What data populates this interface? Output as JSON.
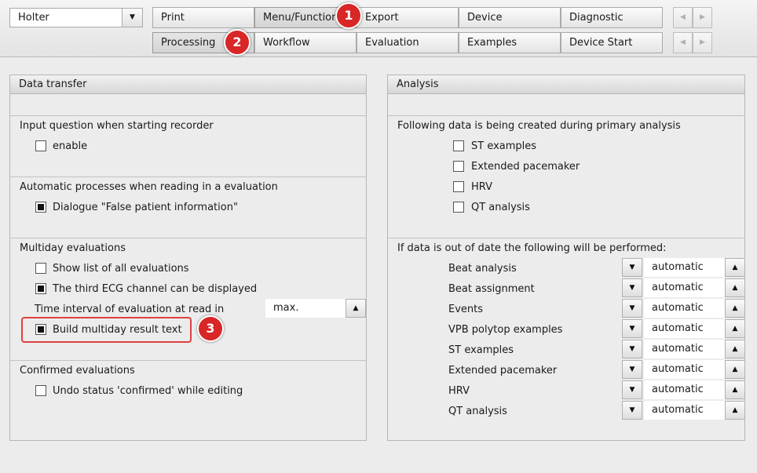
{
  "mode_select": {
    "value": "Holter"
  },
  "tabs_row1": [
    "Print",
    "Menu/Functions",
    "Export",
    "Device",
    "Diagnostic"
  ],
  "tabs_row2": [
    "Processing",
    "Workflow",
    "Evaluation",
    "Examples",
    "Device Start"
  ],
  "badges": [
    "1",
    "2",
    "3"
  ],
  "data_transfer": {
    "title": "Data transfer",
    "input_question": {
      "heading": "Input question when starting recorder",
      "enable": "enable"
    },
    "automatic": {
      "heading": "Automatic processes when reading in a evaluation",
      "dialogue": "Dialogue \"False patient information\""
    },
    "multiday": {
      "heading": "Multiday evaluations",
      "show_list": "Show list of all evaluations",
      "third_channel": "The third ECG channel can be displayed",
      "interval_label": "Time interval of evaluation at read in",
      "interval_value": "max.",
      "build_text": "Build multiday result text"
    },
    "confirmed": {
      "heading": "Confirmed evaluations",
      "undo": "Undo status 'confirmed' while editing"
    }
  },
  "analysis": {
    "title": "Analysis",
    "primary_heading": "Following data is being created during primary analysis",
    "primary_items": [
      "ST examples",
      "Extended pacemaker",
      "HRV",
      "QT analysis"
    ],
    "outdated_heading": "If data is out of date the following will be performed:",
    "outdated_items": [
      {
        "label": "Beat analysis",
        "value": "automatic"
      },
      {
        "label": "Beat assignment",
        "value": "automatic"
      },
      {
        "label": "Events",
        "value": "automatic"
      },
      {
        "label": "VPB polytop examples",
        "value": "automatic"
      },
      {
        "label": "ST examples",
        "value": "automatic"
      },
      {
        "label": "Extended pacemaker",
        "value": "automatic"
      },
      {
        "label": "HRV",
        "value": "automatic"
      },
      {
        "label": "QT analysis",
        "value": "automatic"
      }
    ]
  },
  "icons": {
    "dropdown": "triangle-down-icon",
    "up": "triangle-up-icon",
    "prev": "triangle-left-icon",
    "next": "triangle-right-icon"
  }
}
